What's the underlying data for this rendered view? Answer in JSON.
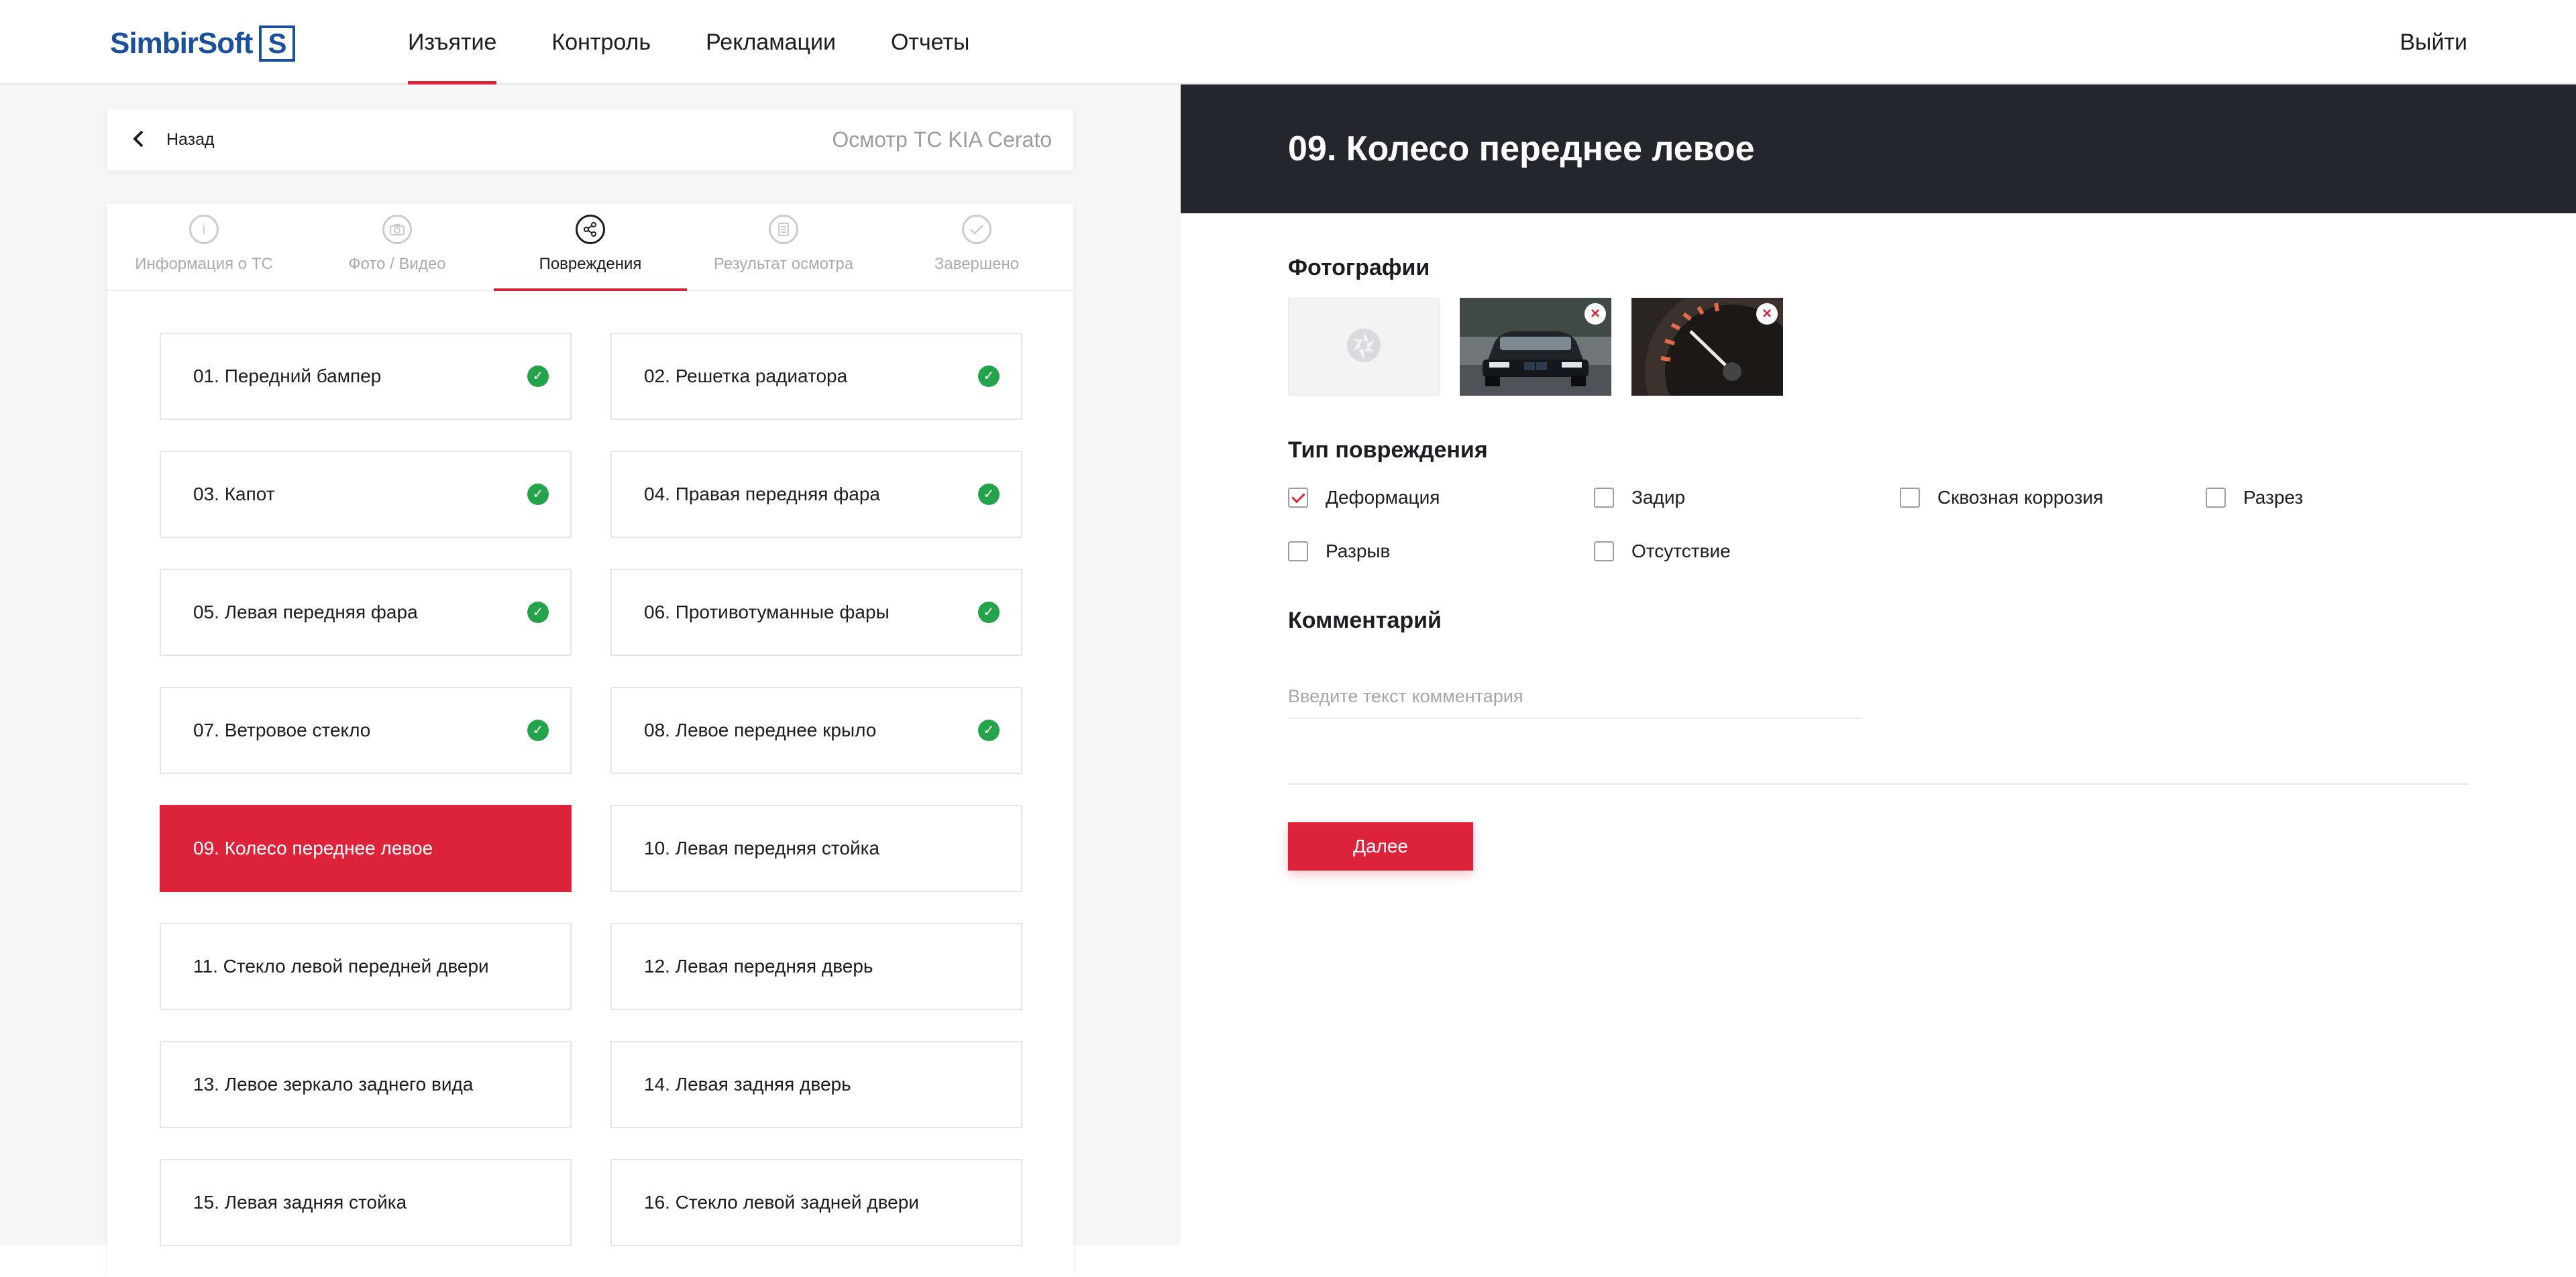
{
  "brand": {
    "name": "SimbirSoft",
    "mark": "S"
  },
  "nav": {
    "items": [
      {
        "label": "Изъятие",
        "active": true
      },
      {
        "label": "Контроль",
        "active": false
      },
      {
        "label": "Рекламации",
        "active": false
      },
      {
        "label": "Отчеты",
        "active": false
      }
    ],
    "logout": "Выйти"
  },
  "back": {
    "label": "Назад",
    "title": "Осмотр ТС KIA Cerato"
  },
  "steps": [
    {
      "label": "Информация о ТС",
      "icon": "info-icon",
      "active": false
    },
    {
      "label": "Фото / Видео",
      "icon": "camera-icon",
      "active": false
    },
    {
      "label": "Повреждения",
      "icon": "share-icon",
      "active": true
    },
    {
      "label": "Результат осмотра",
      "icon": "document-icon",
      "active": false
    },
    {
      "label": "Завершено",
      "icon": "check-icon",
      "active": false
    }
  ],
  "parts": [
    {
      "label": "01. Передний бампер",
      "done": true
    },
    {
      "label": "02. Решетка радиатора",
      "done": true
    },
    {
      "label": "03. Капот",
      "done": true
    },
    {
      "label": "04. Правая передняя фара",
      "done": true
    },
    {
      "label": "05. Левая передняя фара",
      "done": true
    },
    {
      "label": "06. Противотуманные фары",
      "done": true
    },
    {
      "label": "07. Ветровое стекло",
      "done": true
    },
    {
      "label": "08. Левое переднее крыло",
      "done": true
    },
    {
      "label": "09. Колесо переднее левое",
      "done": false,
      "active": true
    },
    {
      "label": "10. Левая передняя стойка",
      "done": false
    },
    {
      "label": "11. Стекло левой передней двери",
      "done": false
    },
    {
      "label": "12. Левая передняя дверь",
      "done": false
    },
    {
      "label": "13. Левое зеркало заднего вида",
      "done": false
    },
    {
      "label": "14. Левая задняя дверь",
      "done": false
    },
    {
      "label": "15. Левая задняя стойка",
      "done": false
    },
    {
      "label": "16. Стекло левой задней двери",
      "done": false
    }
  ],
  "detail": {
    "title": "09. Колесо переднее левое",
    "photos_title": "Фотографии",
    "photos": [
      {
        "icon": "car-photo-icon"
      },
      {
        "icon": "speedometer-photo-icon"
      }
    ],
    "damage_title": "Тип повреждения",
    "damage_types": [
      {
        "label": "Деформация",
        "checked": true
      },
      {
        "label": "Задир",
        "checked": false
      },
      {
        "label": "Сквозная коррозия",
        "checked": false
      },
      {
        "label": "Разрез",
        "checked": false
      },
      {
        "label": "Разрыв",
        "checked": false
      },
      {
        "label": "Отсутствие",
        "checked": false
      }
    ],
    "comment_title": "Комментарий",
    "comment_placeholder": "Введите текст комментария",
    "comment_value": "",
    "next_label": "Далее"
  },
  "colors": {
    "accent": "#dc233a",
    "brand": "#1c4f9c",
    "success": "#24a44a",
    "header_dark": "#24262d"
  }
}
